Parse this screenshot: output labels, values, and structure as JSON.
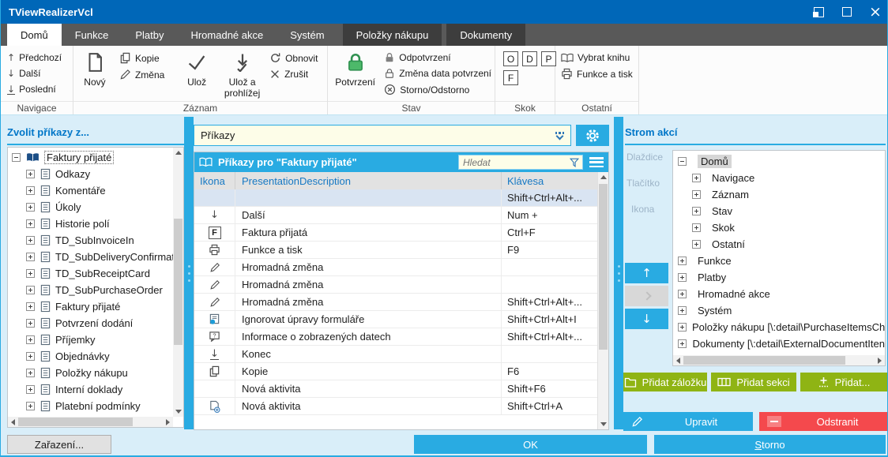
{
  "window": {
    "title": "TViewRealizerVcl"
  },
  "tabs": [
    {
      "label": "Domů",
      "state": "active"
    },
    {
      "label": "Funkce",
      "state": "normal"
    },
    {
      "label": "Platby",
      "state": "normal"
    },
    {
      "label": "Hromadné akce",
      "state": "normal"
    },
    {
      "label": "Systém",
      "state": "normal"
    },
    {
      "label": "Položky nákupu",
      "state": "context"
    },
    {
      "label": "Dokumenty",
      "state": "context"
    }
  ],
  "ribbon": {
    "groups": {
      "navigace": {
        "caption": "Navigace",
        "predchozi": "Předchozí",
        "dalsi": "Další",
        "posledni": "Poslední"
      },
      "zaznam": {
        "caption": "Záznam",
        "novy": "Nový",
        "kopie": "Kopie",
        "zmena": "Změna",
        "uloz": "Ulož",
        "uloz_a_prohlizej": "Ulož a prohlížej",
        "obnovit": "Obnovit",
        "zrusit": "Zrušit"
      },
      "stav": {
        "caption": "Stav",
        "potvrzeni": "Potvrzení",
        "odpotvrzeni": "Odpotvrzení",
        "zmena_data": "Změna data potvrzení",
        "storno_odstorno": "Storno/Odstorno"
      },
      "skok": {
        "caption": "Skok",
        "o": "O",
        "d": "D",
        "p": "P",
        "f": "F"
      },
      "ostatni": {
        "caption": "Ostatní",
        "vybrat_knihu": "Vybrat knihu",
        "funkce_a_tisk": "Funkce a tisk"
      }
    }
  },
  "left_panel": {
    "header": "Zvolit příkazy z...",
    "tree": [
      {
        "label": "Faktury přijaté",
        "level": 0,
        "expander": "minus",
        "icon": "book-icon",
        "focused": true
      },
      {
        "label": "Odkazy",
        "level": 1,
        "expander": "plus",
        "icon": "document-icon"
      },
      {
        "label": "Komentáře",
        "level": 1,
        "expander": "plus",
        "icon": "document-icon"
      },
      {
        "label": "Úkoly",
        "level": 1,
        "expander": "plus",
        "icon": "document-icon"
      },
      {
        "label": "Historie polí",
        "level": 1,
        "expander": "plus",
        "icon": "document-icon"
      },
      {
        "label": "TD_SubInvoiceIn",
        "level": 1,
        "expander": "plus",
        "icon": "document-icon"
      },
      {
        "label": "TD_SubDeliveryConfirmat",
        "level": 1,
        "expander": "plus",
        "icon": "document-icon"
      },
      {
        "label": "TD_SubReceiptCard",
        "level": 1,
        "expander": "plus",
        "icon": "document-icon"
      },
      {
        "label": "TD_SubPurchaseOrder",
        "level": 1,
        "expander": "plus",
        "icon": "document-icon"
      },
      {
        "label": "Faktury přijaté",
        "level": 1,
        "expander": "plus",
        "icon": "document-icon"
      },
      {
        "label": "Potvrzení dodání",
        "level": 1,
        "expander": "plus",
        "icon": "document-icon"
      },
      {
        "label": "Příjemky",
        "level": 1,
        "expander": "plus",
        "icon": "document-icon"
      },
      {
        "label": "Objednávky",
        "level": 1,
        "expander": "plus",
        "icon": "document-icon"
      },
      {
        "label": "Položky nákupu",
        "level": 1,
        "expander": "plus",
        "icon": "document-icon"
      },
      {
        "label": "Interní doklady",
        "level": 1,
        "expander": "plus",
        "icon": "document-icon"
      },
      {
        "label": "Platební podmínky",
        "level": 1,
        "expander": "plus",
        "icon": "document-icon"
      }
    ],
    "zarazeni_button": "Zařazení..."
  },
  "middle_panel": {
    "combo_value": "Příkazy",
    "table_title": "Příkazy pro \"Faktury přijaté\"",
    "search_placeholder": "Hledat",
    "columns": {
      "ikona": "Ikona",
      "presentation": "PresentationDescription",
      "klavesa": "Klávesa"
    },
    "rows": [
      {
        "icon": "",
        "label": "",
        "key": "Shift+Ctrl+Alt+...",
        "selected": true
      },
      {
        "icon": "arrow-down-icon",
        "label": "Další",
        "key": "Num +"
      },
      {
        "icon": "letter-f-icon",
        "label": "Faktura přijatá",
        "key": "Ctrl+F"
      },
      {
        "icon": "printer-icon",
        "label": "Funkce a tisk",
        "key": "F9"
      },
      {
        "icon": "pencil-icon",
        "label": "Hromadná změna",
        "key": ""
      },
      {
        "icon": "pencil-icon",
        "label": "Hromadná změna",
        "key": ""
      },
      {
        "icon": "pencil-icon",
        "label": "Hromadná změna",
        "key": "Shift+Ctrl+Alt+..."
      },
      {
        "icon": "form-ignore-icon",
        "label": "Ignorovat úpravy formuláře",
        "key": "Shift+Ctrl+Alt+I"
      },
      {
        "icon": "info-bubble-icon",
        "label": "Informace o zobrazených datech",
        "key": "Shift+Ctrl+Alt+..."
      },
      {
        "icon": "exit-icon",
        "label": "Konec",
        "key": ""
      },
      {
        "icon": "copy-icon",
        "label": "Kopie",
        "key": "F6"
      },
      {
        "icon": "",
        "label": "Nová aktivita",
        "key": "Shift+F6"
      },
      {
        "icon": "doc-plus-icon",
        "label": "Nová aktivita",
        "key": "Shift+Ctrl+A"
      }
    ]
  },
  "right_panel": {
    "header": "Strom akcí",
    "side_labels": {
      "dlazdice": "Dlaždice",
      "tlacitko": "Tlačítko",
      "ikona": "Ikona"
    },
    "tree": [
      {
        "label": "Domů",
        "level": 0,
        "expander": "minus",
        "selected": true
      },
      {
        "label": "Navigace",
        "level": 1,
        "expander": "plus"
      },
      {
        "label": "Záznam",
        "level": 1,
        "expander": "plus"
      },
      {
        "label": "Stav",
        "level": 1,
        "expander": "plus"
      },
      {
        "label": "Skok",
        "level": 1,
        "expander": "plus"
      },
      {
        "label": "Ostatní",
        "level": 1,
        "expander": "plus"
      },
      {
        "label": "Funkce",
        "level": 0,
        "expander": "plus"
      },
      {
        "label": "Platby",
        "level": 0,
        "expander": "plus"
      },
      {
        "label": "Hromadné akce",
        "level": 0,
        "expander": "plus"
      },
      {
        "label": "Systém",
        "level": 0,
        "expander": "plus"
      },
      {
        "label": "Položky nákupu [\\:detail\\PurchaseItemsChi",
        "level": 0,
        "expander": "plus"
      },
      {
        "label": "Dokumenty [\\:detail\\ExternalDocumentIten",
        "level": 0,
        "expander": "plus"
      }
    ],
    "buttons": {
      "add_tab": "Přidat záložku",
      "add_section": "Přidat sekci",
      "add": "Přidat...",
      "edit": "Upravit",
      "remove": "Odstranit"
    }
  },
  "footer": {
    "zarazeni": "Zařazení...",
    "ok": "OK",
    "storno": "Storno"
  },
  "colors": {
    "titlebar": "#0067b8",
    "accent": "#29abe2",
    "green_button": "#8fb414",
    "red_button": "#f4494d",
    "confirm_lock_green": "#4db96a",
    "selected_row": "#d9e4f2",
    "input_yellow": "#fdfde8"
  }
}
